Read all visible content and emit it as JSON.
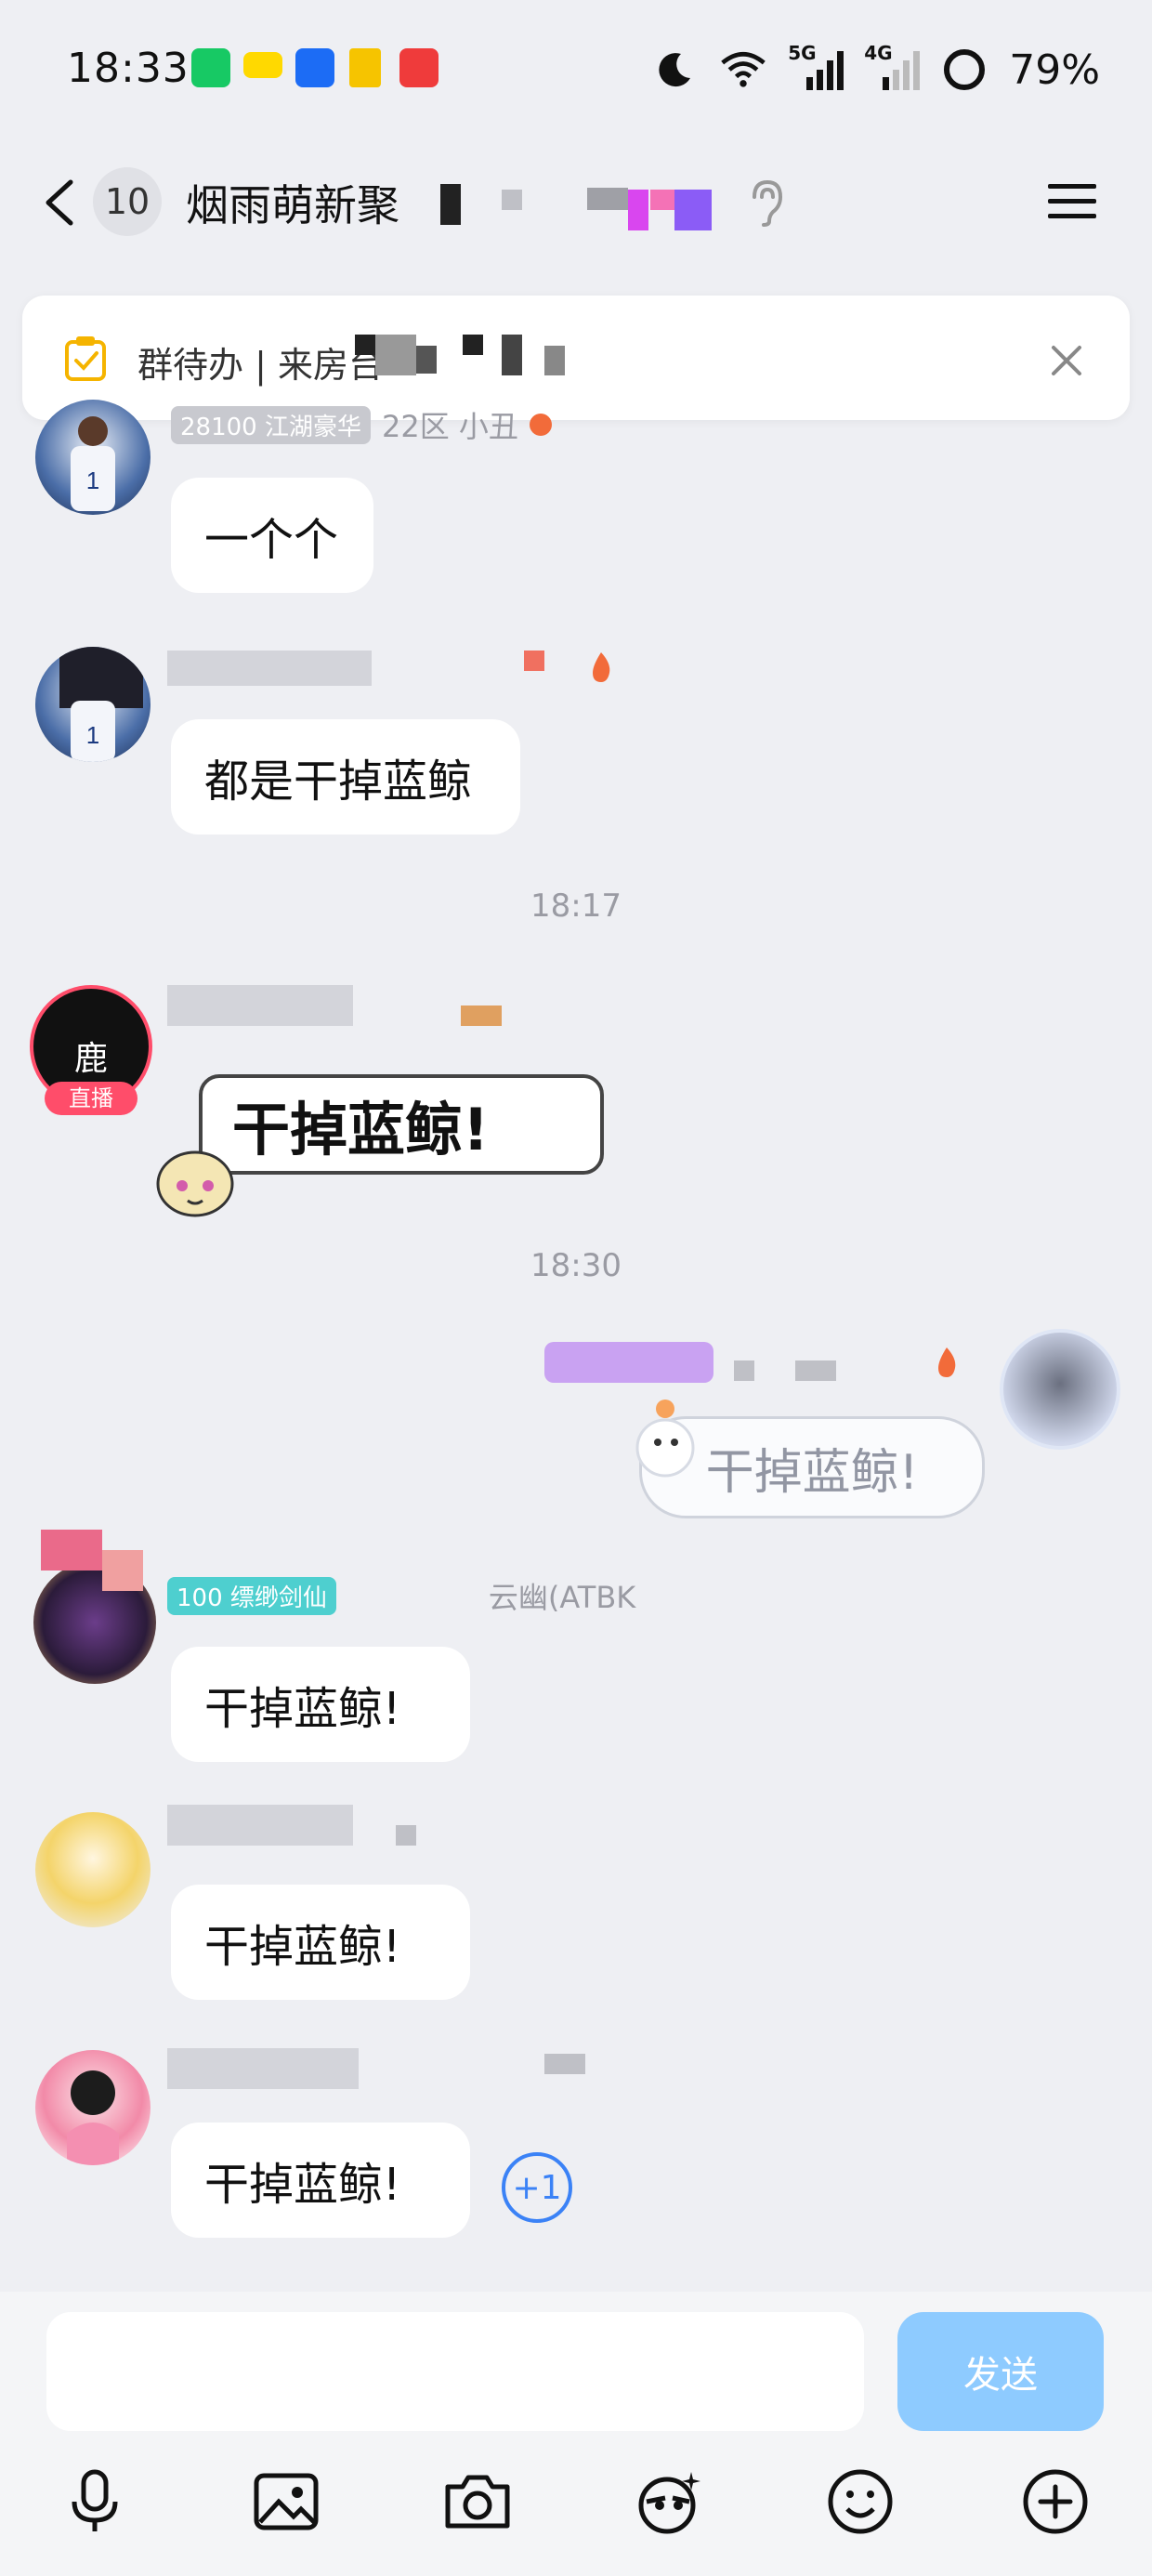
{
  "status_bar": {
    "time": "18:33",
    "network_5g": "5G",
    "network_4g": "4G",
    "battery": "79%"
  },
  "header": {
    "unread_count": "10",
    "group_title": "烟雨萌新聚"
  },
  "notice": {
    "text": "群待办 | 来房台"
  },
  "messages": [
    {
      "id": 1,
      "level_tag": "28100 江湖豪华",
      "sender_note": "22区 小丑",
      "text": "一个个"
    },
    {
      "id": 2,
      "text": "都是干掉蓝鲸"
    },
    {
      "id": 3,
      "avatar_text": "鹿",
      "live_badge": "直播",
      "sticker_text": "干掉蓝鲸!"
    },
    {
      "id": 4,
      "sticker_text": "干掉蓝鲸!"
    },
    {
      "id": 5,
      "level_tag": "100 缥缈剑仙",
      "sender_note": "云幽(ATBK",
      "text": "干掉蓝鲸!"
    },
    {
      "id": 6,
      "text": "干掉蓝鲸!"
    },
    {
      "id": 7,
      "text": "干掉蓝鲸!",
      "reaction": "+1"
    }
  ],
  "time_dividers": [
    "18:17",
    "18:30"
  ],
  "input": {
    "placeholder": "",
    "send_label": "发送"
  },
  "toolbar": [
    "microphone-icon",
    "image-icon",
    "camera-icon",
    "red-packet-icon",
    "emoji-icon",
    "plus-icon"
  ],
  "colors": {
    "background": "#eeeff3",
    "send_button": "#8ecbff",
    "reaction_blue": "#3b82f6",
    "live_badge": "#ff4d6a"
  }
}
